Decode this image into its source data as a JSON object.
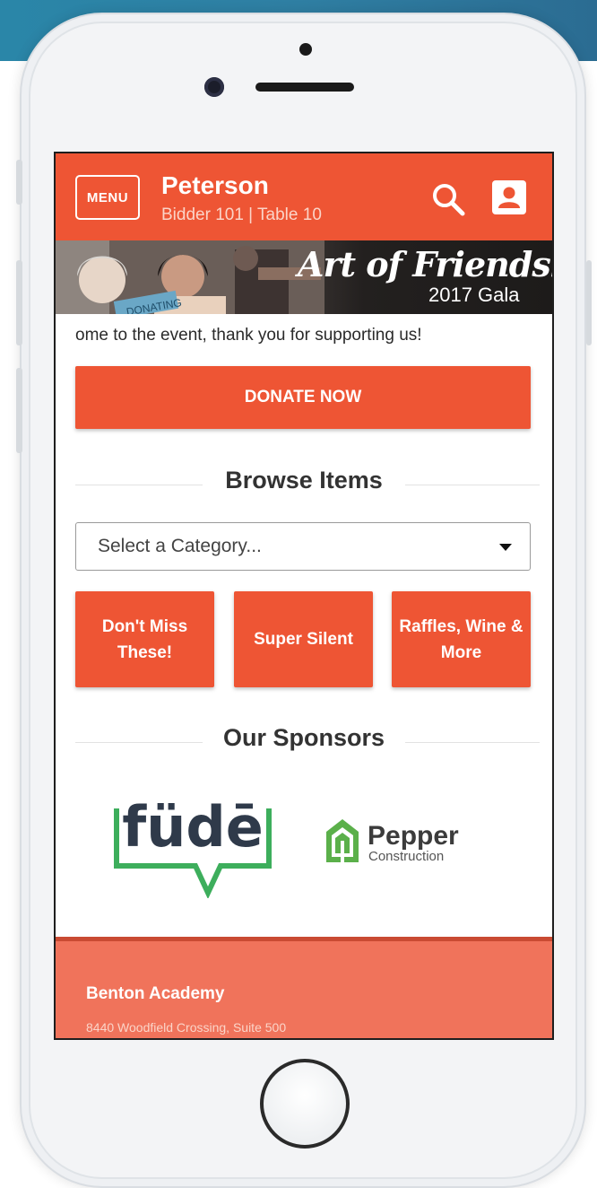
{
  "header": {
    "menu_label": "MENU",
    "user_name": "Peterson",
    "user_sub": "Bidder 101 | Table 10",
    "search_icon": "search-icon",
    "account_icon": "account-icon"
  },
  "banner": {
    "title": "Art of Friendship",
    "subtitle": "2017 Gala",
    "sign_text": "DONATING"
  },
  "welcome_text": "ome to the event, thank you for supporting us!",
  "donate_label": "DONATE NOW",
  "browse": {
    "title": "Browse Items",
    "select_value": "Select a Category...",
    "categories": [
      "Don't Miss These!",
      "Super Silent",
      "Raffles, Wine & More"
    ]
  },
  "sponsors": {
    "title": "Our Sponsors",
    "fude": "füdē",
    "pepper_name": "Pepper",
    "pepper_sub": "Construction"
  },
  "footer": {
    "name": "Benton Academy",
    "address": "8440 Woodfield Crossing, Suite 500"
  },
  "colors": {
    "accent": "#ee5534",
    "footer": "#f0735b",
    "fude_green": "#3dae5c",
    "fude_dark": "#2f3a4a"
  }
}
